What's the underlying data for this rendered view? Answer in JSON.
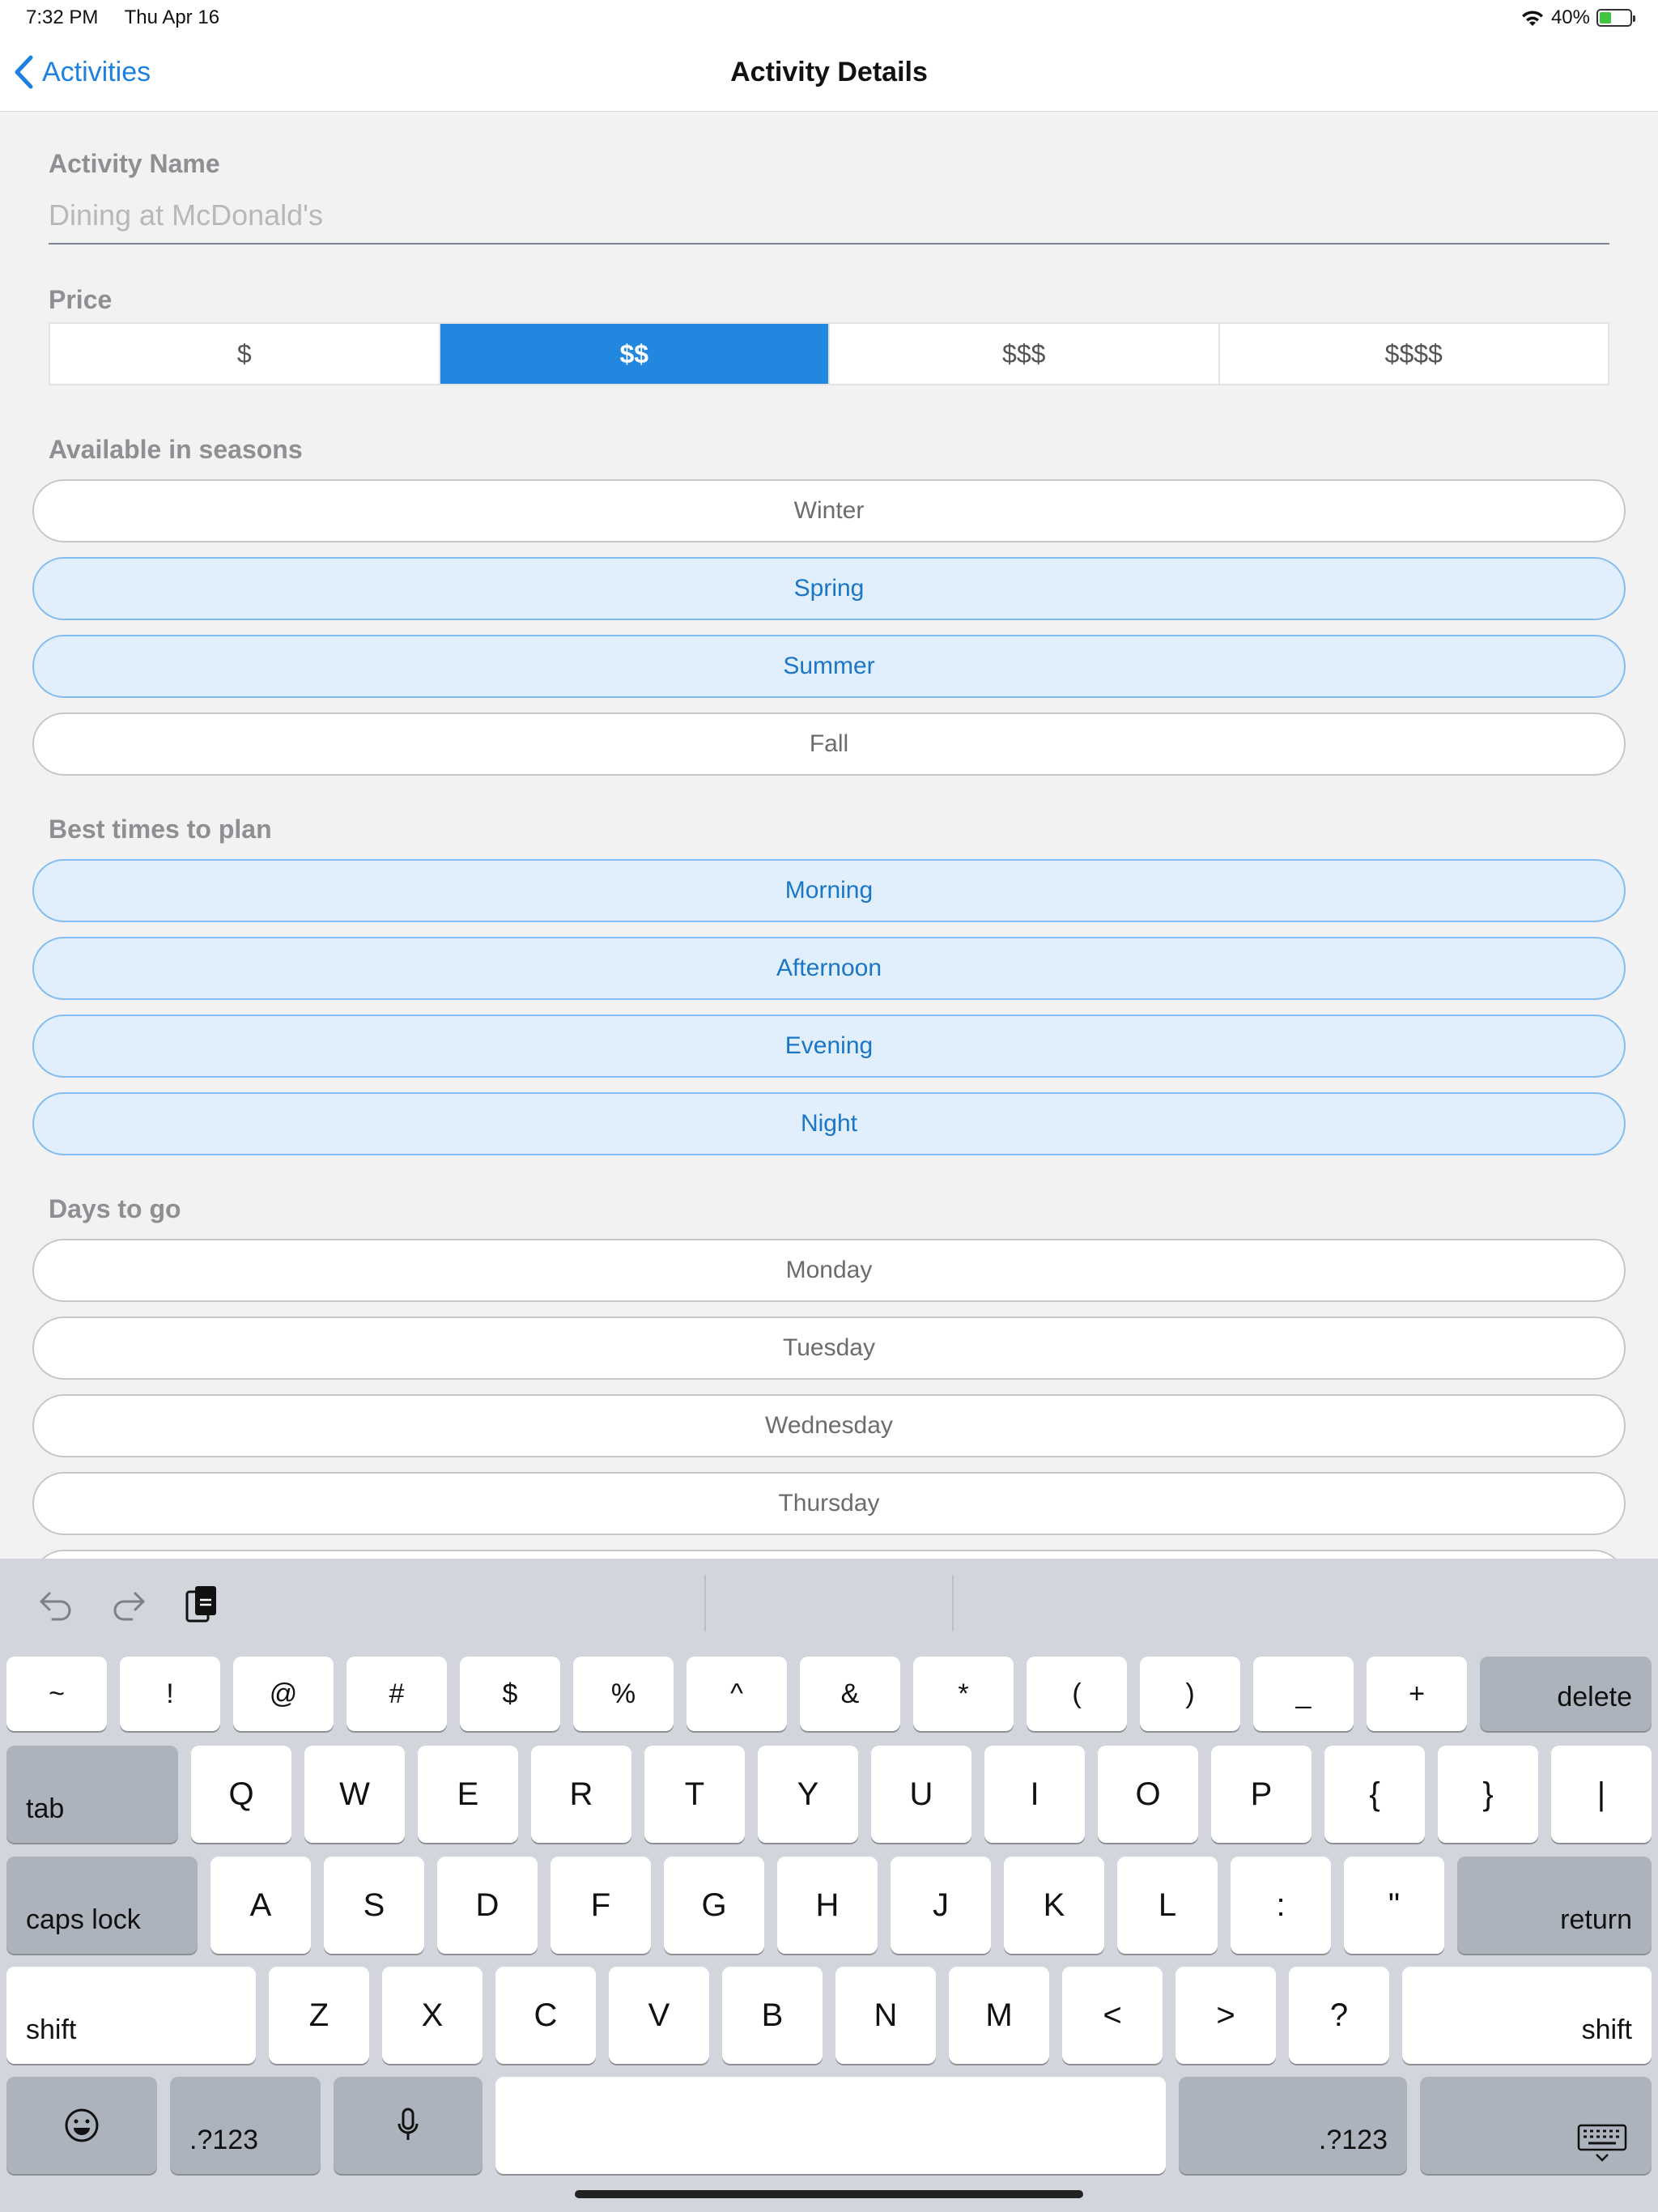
{
  "status": {
    "time": "7:32 PM",
    "date": "Thu Apr 16",
    "battery": "40%"
  },
  "nav": {
    "back_label": "Activities",
    "title": "Activity Details"
  },
  "activity_name": {
    "label": "Activity Name",
    "value": "Dining at McDonald's"
  },
  "price": {
    "label": "Price",
    "options": [
      "$",
      "$$",
      "$$$",
      "$$$$"
    ],
    "selected": "$$"
  },
  "seasons": {
    "label": "Available in seasons",
    "items": [
      {
        "label": "Winter",
        "selected": false
      },
      {
        "label": "Spring",
        "selected": true
      },
      {
        "label": "Summer",
        "selected": true
      },
      {
        "label": "Fall",
        "selected": false
      }
    ]
  },
  "times": {
    "label": "Best times to plan",
    "items": [
      {
        "label": "Morning",
        "selected": true
      },
      {
        "label": "Afternoon",
        "selected": true
      },
      {
        "label": "Evening",
        "selected": true
      },
      {
        "label": "Night",
        "selected": true
      }
    ]
  },
  "days": {
    "label": "Days to go",
    "items": [
      {
        "label": "Monday",
        "selected": false
      },
      {
        "label": "Tuesday",
        "selected": false
      },
      {
        "label": "Wednesday",
        "selected": false
      },
      {
        "label": "Thursday",
        "selected": false
      }
    ]
  },
  "keyboard": {
    "row1": [
      "~",
      "!",
      "@",
      "#",
      "$",
      "%",
      "^",
      "&",
      "*",
      "(",
      ")",
      "_",
      "+"
    ],
    "delete": "delete",
    "tab": "tab",
    "row2": [
      "Q",
      "W",
      "E",
      "R",
      "T",
      "Y",
      "U",
      "I",
      "O",
      "P",
      "{",
      "}",
      "|"
    ],
    "caps_lock": "caps lock",
    "row3": [
      "A",
      "S",
      "D",
      "F",
      "G",
      "H",
      "J",
      "K",
      "L",
      ":",
      "\""
    ],
    "return": "return",
    "shift": "shift",
    "row4": [
      "Z",
      "X",
      "C",
      "V",
      "B",
      "N",
      "M",
      "<",
      ">",
      "?"
    ],
    "numbers": ".?123"
  },
  "colors": {
    "accent": "#2287de",
    "selected_pill_bg": "#e1effc",
    "selected_pill_text": "#1b76c6"
  }
}
